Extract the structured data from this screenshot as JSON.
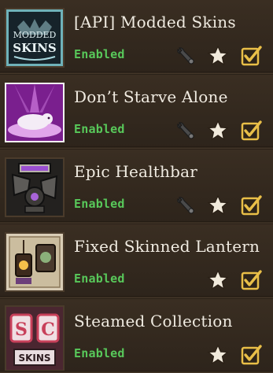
{
  "mods": [
    {
      "title": "[API] Modded Skins",
      "status": "Enabled",
      "has_config": true,
      "icon": "modded-skins-logo",
      "thumb_text": [
        "MODDED",
        "SKINS"
      ]
    },
    {
      "title": "Don’t Starve Alone",
      "status": "Enabled",
      "has_config": true,
      "icon": "pink-beast-thumbnail"
    },
    {
      "title": "Epic Healthbar",
      "status": "Enabled",
      "has_config": true,
      "icon": "healthbar-robot-thumbnail"
    },
    {
      "title": "Fixed Skinned Lantern ...",
      "status": "Enabled",
      "has_config": false,
      "icon": "lantern-thumbnail"
    },
    {
      "title": "Steamed Collection",
      "status": "Enabled",
      "has_config": false,
      "icon": "sc-skins-thumbnail",
      "thumb_text": [
        "S",
        "C",
        "SKINS"
      ]
    }
  ],
  "colors": {
    "enabled": "#58c85a",
    "title": "#f0ebe1",
    "row": "#34291f",
    "accent_gold": "#e9bf48"
  }
}
